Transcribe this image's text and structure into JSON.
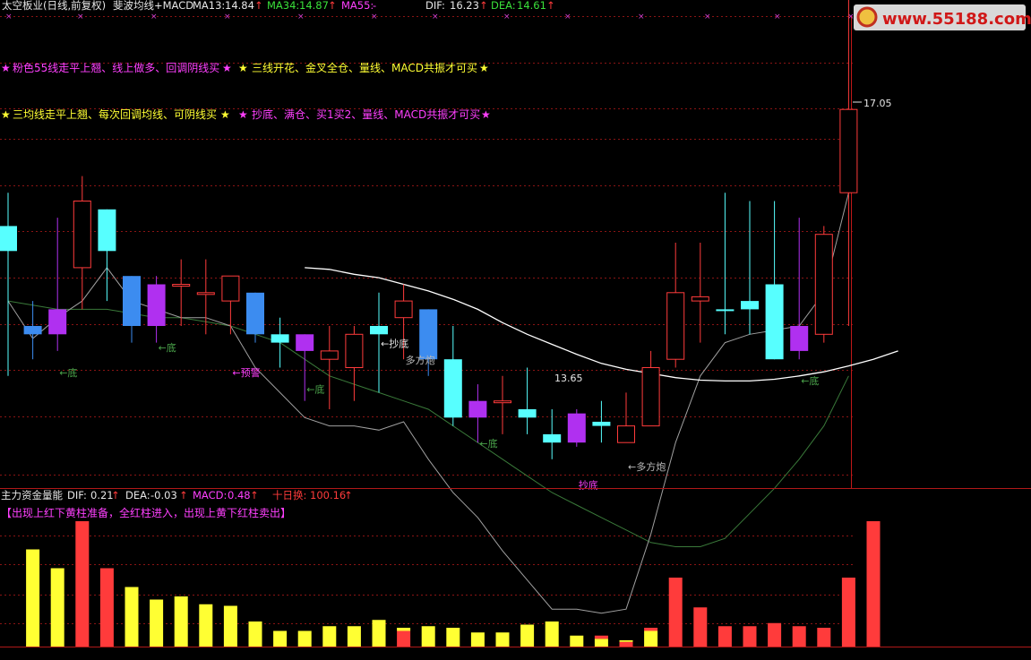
{
  "header": {
    "title": "太空板业(日线,前复权)",
    "indicator": "斐波均线+MACD",
    "ma13_label": "MA13:",
    "ma13_value": "14.84",
    "ma34_label": "MA34:",
    "ma34_value": "14.87",
    "ma55_label": "MA55:",
    "ma55_value": "-",
    "dif_label": "DIF:",
    "dif_value": "16.23",
    "dea_label": "DEA:",
    "dea_value": "14.61",
    "arrow": "↑"
  },
  "watermark": "www.55188.com",
  "notes": {
    "line1_left": "粉色55线走平上翘、线上做多、回调阴线买",
    "line1_right": "三线开花、金叉全仓、量线、MACD共振才可买",
    "line2_left": "三均线走平上翘、每次回调均线、可阴线买",
    "line2_right": "抄底、满仓、买1买2、量线、MACD共振才可买",
    "star": "★"
  },
  "lower_header": {
    "title": "主力资金量能",
    "dif_label": "DIF:",
    "dif_value": "0.21",
    "dea_label": "DEA:",
    "dea_value": "-0.03",
    "macd_label": "MACD:",
    "macd_value": "0.48",
    "turnover_label": "十日换:",
    "turnover_value": "100.16",
    "arrow": "↑",
    "hint": "【出现上红下黄柱准备，全红柱进入，出现上黄下红柱卖出】"
  },
  "colors": {
    "up": "#ff3b3b",
    "down_cyan": "#57ffff",
    "down_blue": "#3c8cf0",
    "purple": "#b030f0",
    "ma_white": "#ffffff",
    "ma_gray": "#a0a0a0",
    "ma_green": "#3a7a3a",
    "grid": "#8a1414",
    "magenta": "#ff40ff",
    "yellow": "#ffff33",
    "text_white": "#e6e6e6",
    "annot_green": "#4aa34a"
  },
  "chart_data": [
    {
      "type": "candlestick",
      "title": "太空板业(日线,前复权)",
      "candles": [
        {
          "o": 16.2,
          "h": 16.6,
          "l": 14.4,
          "c": 15.9,
          "color": "cyan"
        },
        {
          "o": 15.0,
          "h": 15.3,
          "l": 14.6,
          "c": 14.9,
          "color": "blue"
        },
        {
          "o": 15.2,
          "h": 16.3,
          "l": 14.7,
          "c": 14.9,
          "color": "purple"
        },
        {
          "o": 16.5,
          "h": 16.8,
          "l": 15.2,
          "c": 15.7,
          "color": "red"
        },
        {
          "o": 16.4,
          "h": 16.4,
          "l": 15.3,
          "c": 15.9,
          "color": "cyan"
        },
        {
          "o": 15.6,
          "h": 15.6,
          "l": 14.8,
          "c": 15.0,
          "color": "blue"
        },
        {
          "o": 15.5,
          "h": 15.6,
          "l": 14.8,
          "c": 15.0,
          "color": "purple"
        },
        {
          "o": 15.5,
          "h": 15.8,
          "l": 15.0,
          "c": 15.5,
          "color": "red"
        },
        {
          "o": 15.4,
          "h": 15.8,
          "l": 14.9,
          "c": 15.4,
          "color": "red"
        },
        {
          "o": 15.3,
          "h": 15.6,
          "l": 14.9,
          "c": 15.6,
          "color": "red"
        },
        {
          "o": 15.4,
          "h": 15.4,
          "l": 14.8,
          "c": 14.9,
          "color": "blue"
        },
        {
          "o": 14.9,
          "h": 15.1,
          "l": 14.5,
          "c": 14.8,
          "color": "cyan"
        },
        {
          "o": 14.9,
          "h": 14.9,
          "l": 14.1,
          "c": 14.7,
          "color": "purple"
        },
        {
          "o": 14.6,
          "h": 15.0,
          "l": 14.0,
          "c": 14.7,
          "color": "red"
        },
        {
          "o": 14.5,
          "h": 15.0,
          "l": 14.1,
          "c": 14.9,
          "color": "red"
        },
        {
          "o": 14.9,
          "h": 15.4,
          "l": 14.2,
          "c": 15.0,
          "color": "cyan"
        },
        {
          "o": 15.1,
          "h": 15.5,
          "l": 14.6,
          "c": 15.3,
          "color": "red"
        },
        {
          "o": 15.2,
          "h": 15.2,
          "l": 14.4,
          "c": 14.6,
          "color": "blue"
        },
        {
          "o": 14.6,
          "h": 15.0,
          "l": 13.8,
          "c": 13.9,
          "color": "cyan"
        },
        {
          "o": 14.1,
          "h": 14.3,
          "l": 13.6,
          "c": 13.9,
          "color": "purple"
        },
        {
          "o": 14.1,
          "h": 14.4,
          "l": 13.7,
          "c": 14.1,
          "color": "red"
        },
        {
          "o": 14.0,
          "h": 14.5,
          "l": 13.7,
          "c": 13.9,
          "color": "cyan"
        },
        {
          "o": 13.7,
          "h": 14.0,
          "l": 13.4,
          "c": 13.6,
          "color": "cyan"
        },
        {
          "o": 13.95,
          "h": 14.0,
          "l": 13.55,
          "c": 13.6,
          "color": "purple"
        },
        {
          "o": 13.85,
          "h": 14.1,
          "l": 13.6,
          "c": 13.8,
          "color": "cyan"
        },
        {
          "o": 13.6,
          "h": 14.2,
          "l": 13.6,
          "c": 13.8,
          "color": "red"
        },
        {
          "o": 13.8,
          "h": 14.7,
          "l": 13.8,
          "c": 14.5,
          "color": "red"
        },
        {
          "o": 14.6,
          "h": 16.0,
          "l": 14.5,
          "c": 15.4,
          "color": "red"
        },
        {
          "o": 15.3,
          "h": 16.0,
          "l": 14.8,
          "c": 15.35,
          "color": "red"
        },
        {
          "o": 15.2,
          "h": 16.6,
          "l": 14.9,
          "c": 15.2,
          "color": "cyan"
        },
        {
          "o": 15.3,
          "h": 16.5,
          "l": 14.9,
          "c": 15.2,
          "color": "cyan"
        },
        {
          "o": 15.5,
          "h": 16.5,
          "l": 14.6,
          "c": 14.6,
          "color": "cyan"
        },
        {
          "o": 15.0,
          "h": 16.3,
          "l": 14.6,
          "c": 14.7,
          "color": "purple"
        },
        {
          "o": 14.9,
          "h": 16.2,
          "l": 14.8,
          "c": 16.1,
          "color": "red"
        },
        {
          "o": 16.6,
          "h": 19.3,
          "l": 15.0,
          "c": 17.6,
          "color": "red"
        }
      ],
      "ma_white": {
        "start": 12,
        "values": [
          15.7,
          15.68,
          15.62,
          15.58,
          15.5,
          15.42,
          15.32,
          15.2,
          15.04,
          14.9,
          14.78,
          14.66,
          14.55,
          14.48,
          14.43,
          14.38,
          14.35,
          14.34,
          14.34,
          14.36,
          14.4,
          14.45,
          14.52,
          14.6,
          14.7
        ]
      },
      "ma_gray": [
        15.3,
        14.85,
        15.1,
        15.3,
        15.7,
        15.3,
        15.2,
        15.1,
        15.1,
        15.0,
        14.5,
        14.2,
        13.9,
        13.8,
        13.8,
        13.75,
        13.85,
        13.4,
        13.0,
        12.7,
        12.3,
        11.95,
        11.6,
        11.6,
        11.55,
        11.6,
        12.5,
        13.6,
        14.4,
        14.8,
        14.9,
        14.95,
        15.0,
        15.4,
        16.6
      ],
      "ma_green": [
        15.3,
        15.25,
        15.2,
        15.2,
        15.2,
        15.15,
        15.1,
        15.1,
        15.05,
        15.0,
        14.9,
        14.8,
        14.6,
        14.4,
        14.3,
        14.2,
        14.1,
        14.0,
        13.8,
        13.6,
        13.4,
        13.2,
        13.0,
        12.85,
        12.7,
        12.55,
        12.4,
        12.35,
        12.35,
        12.45,
        12.75,
        13.05,
        13.4,
        13.8,
        14.4
      ],
      "price_label": "17.05",
      "low_label": "13.65",
      "annotations": [
        {
          "i": 2,
          "text": "←底",
          "price": 14.4,
          "color": "green"
        },
        {
          "i": 6,
          "text": "←底",
          "price": 14.7,
          "color": "green"
        },
        {
          "i": 9,
          "text": "←预警",
          "price": 14.4,
          "color": "magenta"
        },
        {
          "i": 12,
          "text": "←底",
          "price": 14.2,
          "color": "green"
        },
        {
          "i": 15,
          "text": "←抄底",
          "price": 14.75,
          "color": "white"
        },
        {
          "i": 16,
          "text": "多方炮",
          "price": 14.55,
          "color": "gray"
        },
        {
          "i": 19,
          "text": "←底",
          "price": 13.55,
          "color": "green"
        },
        {
          "i": 23,
          "text": "抄底",
          "price": 13.05,
          "color": "magenta"
        },
        {
          "i": 25,
          "text": "←多方炮",
          "price": 13.27,
          "color": "gray"
        },
        {
          "i": 32,
          "text": "←底",
          "price": 14.3,
          "color": "green"
        }
      ]
    },
    {
      "type": "bar",
      "title": "主力资金量能",
      "bars": [
        {
          "r": 0,
          "y": 0.62
        },
        {
          "r": 0.5,
          "y": 0.5
        },
        {
          "r": 0.8,
          "y": 0
        },
        {
          "r": 0.5,
          "y": 0
        },
        {
          "r": 0,
          "y": 0.38
        },
        {
          "r": 0,
          "y": 0.3
        },
        {
          "r": 0,
          "y": 0.32
        },
        {
          "r": 0,
          "y": 0.27
        },
        {
          "r": 0,
          "y": 0.26
        },
        {
          "r": 0,
          "y": 0.16
        },
        {
          "r": 0,
          "y": 0.1
        },
        {
          "r": 0,
          "y": 0.1
        },
        {
          "r": 0,
          "y": 0.13
        },
        {
          "r": 0,
          "y": 0.13
        },
        {
          "r": 0,
          "y": 0.17
        },
        {
          "r": 0.1,
          "y": 0.12
        },
        {
          "r": 0,
          "y": 0.13
        },
        {
          "r": 0,
          "y": 0.12
        },
        {
          "r": 0,
          "y": 0.09
        },
        {
          "r": 0,
          "y": 0.09
        },
        {
          "r": 0,
          "y": 0.14
        },
        {
          "r": 0,
          "y": 0.16
        },
        {
          "r": 0.07,
          "y": 0.07
        },
        {
          "r": 0.07,
          "y": 0.05
        },
        {
          "r": 0.03,
          "y": 0.04
        },
        {
          "r": 0.12,
          "y": 0.1
        },
        {
          "r": 0.44,
          "y": 0
        },
        {
          "r": 0.25,
          "y": 0
        },
        {
          "r": 0.13,
          "y": 0
        },
        {
          "r": 0.13,
          "y": 0
        },
        {
          "r": 0.15,
          "y": 0
        },
        {
          "r": 0.13,
          "y": 0
        },
        {
          "r": 0.12,
          "y": 0
        },
        {
          "r": 0.44,
          "y": 0
        },
        {
          "r": 0.8,
          "y": 0
        }
      ]
    }
  ]
}
